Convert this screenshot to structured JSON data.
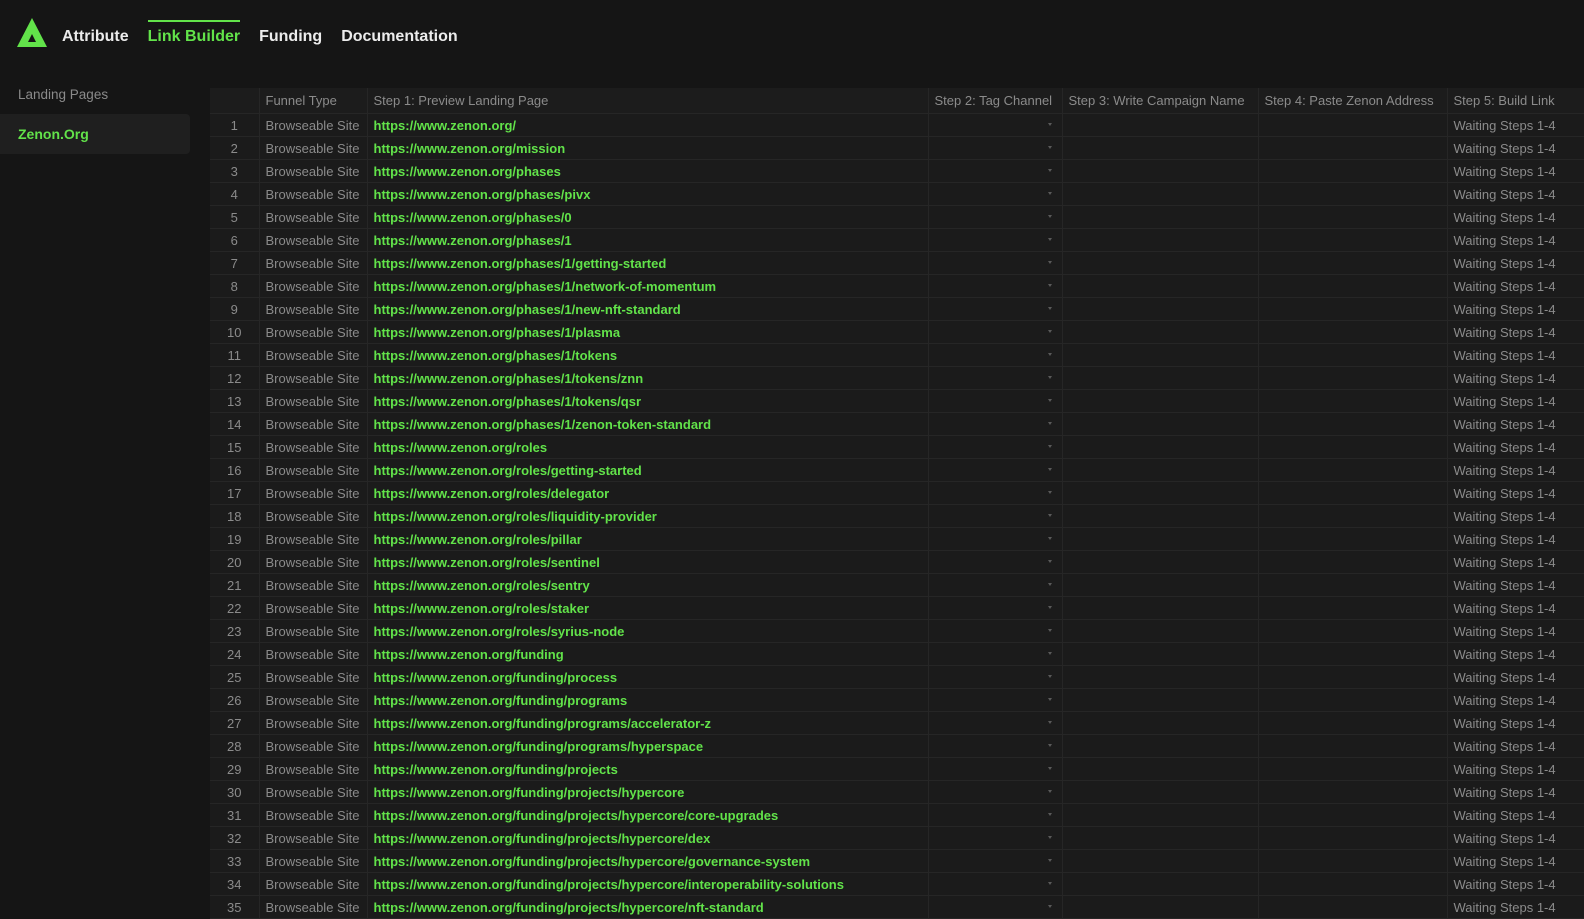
{
  "nav": {
    "items": [
      {
        "label": "Attribute",
        "active": false
      },
      {
        "label": "Link Builder",
        "active": true
      },
      {
        "label": "Funding",
        "active": false
      },
      {
        "label": "Documentation",
        "active": false
      }
    ]
  },
  "sidebar": {
    "heading": "Landing Pages",
    "items": [
      {
        "label": "Zenon.Org",
        "active": true
      }
    ]
  },
  "colors": {
    "accent": "#62e34a",
    "background": "#151515",
    "muted_text": "#8b8b8b"
  },
  "table": {
    "columns": [
      "",
      "Funnel Type",
      "Step 1: Preview Landing Page",
      "Step 2: Tag Channel",
      "Step 3: Write Campaign Name",
      "Step 4: Paste Zenon Address",
      "Step 5: Build Link"
    ],
    "funnel_type": "Browseable Site",
    "status": "Waiting Steps 1-4",
    "rows": [
      {
        "num": "1",
        "url": "https://www.zenon.org/"
      },
      {
        "num": "2",
        "url": "https://www.zenon.org/mission"
      },
      {
        "num": "3",
        "url": "https://www.zenon.org/phases"
      },
      {
        "num": "4",
        "url": "https://www.zenon.org/phases/pivx"
      },
      {
        "num": "5",
        "url": "https://www.zenon.org/phases/0"
      },
      {
        "num": "6",
        "url": "https://www.zenon.org/phases/1"
      },
      {
        "num": "7",
        "url": "https://www.zenon.org/phases/1/getting-started"
      },
      {
        "num": "8",
        "url": "https://www.zenon.org/phases/1/network-of-momentum"
      },
      {
        "num": "9",
        "url": "https://www.zenon.org/phases/1/new-nft-standard"
      },
      {
        "num": "10",
        "url": "https://www.zenon.org/phases/1/plasma"
      },
      {
        "num": "11",
        "url": "https://www.zenon.org/phases/1/tokens"
      },
      {
        "num": "12",
        "url": "https://www.zenon.org/phases/1/tokens/znn"
      },
      {
        "num": "13",
        "url": "https://www.zenon.org/phases/1/tokens/qsr"
      },
      {
        "num": "14",
        "url": "https://www.zenon.org/phases/1/zenon-token-standard"
      },
      {
        "num": "15",
        "url": "https://www.zenon.org/roles"
      },
      {
        "num": "16",
        "url": "https://www.zenon.org/roles/getting-started"
      },
      {
        "num": "17",
        "url": "https://www.zenon.org/roles/delegator"
      },
      {
        "num": "18",
        "url": "https://www.zenon.org/roles/liquidity-provider"
      },
      {
        "num": "19",
        "url": "https://www.zenon.org/roles/pillar"
      },
      {
        "num": "20",
        "url": "https://www.zenon.org/roles/sentinel"
      },
      {
        "num": "21",
        "url": "https://www.zenon.org/roles/sentry"
      },
      {
        "num": "22",
        "url": "https://www.zenon.org/roles/staker"
      },
      {
        "num": "23",
        "url": "https://www.zenon.org/roles/syrius-node"
      },
      {
        "num": "24",
        "url": "https://www.zenon.org/funding"
      },
      {
        "num": "25",
        "url": "https://www.zenon.org/funding/process"
      },
      {
        "num": "26",
        "url": "https://www.zenon.org/funding/programs"
      },
      {
        "num": "27",
        "url": "https://www.zenon.org/funding/programs/accelerator-z"
      },
      {
        "num": "28",
        "url": "https://www.zenon.org/funding/programs/hyperspace"
      },
      {
        "num": "29",
        "url": "https://www.zenon.org/funding/projects"
      },
      {
        "num": "30",
        "url": "https://www.zenon.org/funding/projects/hypercore"
      },
      {
        "num": "31",
        "url": "https://www.zenon.org/funding/projects/hypercore/core-upgrades"
      },
      {
        "num": "32",
        "url": "https://www.zenon.org/funding/projects/hypercore/dex"
      },
      {
        "num": "33",
        "url": "https://www.zenon.org/funding/projects/hypercore/governance-system"
      },
      {
        "num": "34",
        "url": "https://www.zenon.org/funding/projects/hypercore/interoperability-solutions"
      },
      {
        "num": "35",
        "url": "https://www.zenon.org/funding/projects/hypercore/nft-standard"
      }
    ]
  }
}
